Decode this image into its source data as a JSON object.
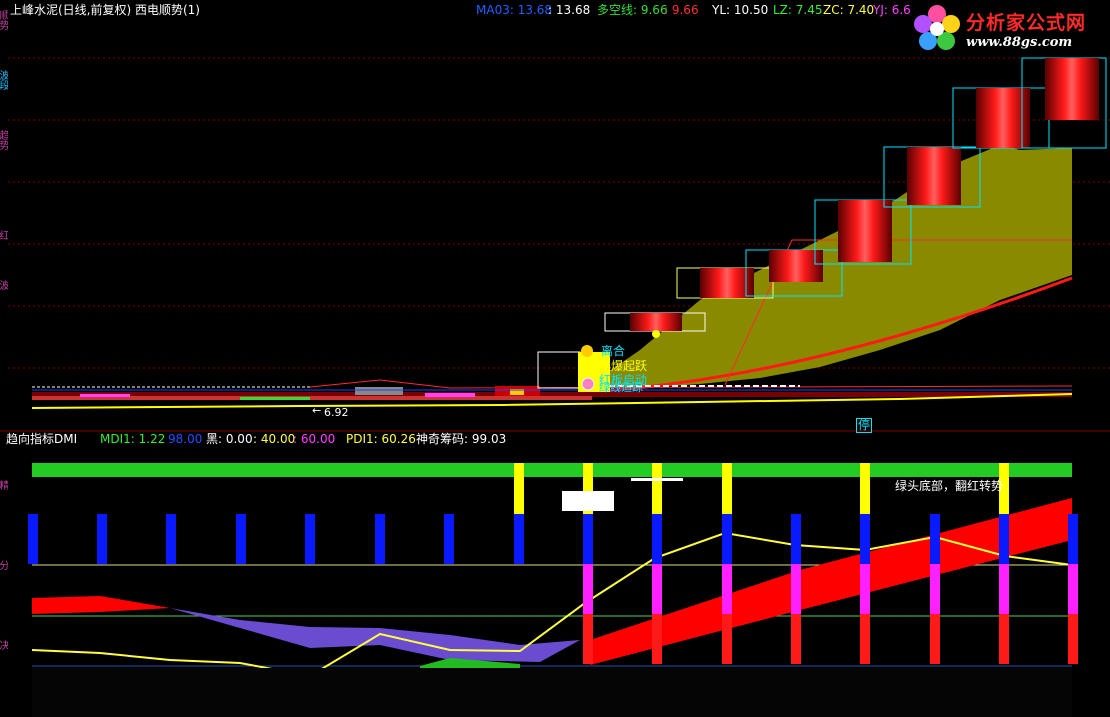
{
  "header": {
    "title": "上峰水泥(日线,前复权) 西电顺势(1)",
    "indicators": [
      {
        "label": "MA03: 13.68",
        "color": "#2060ff"
      },
      {
        "label": ": 13.68",
        "color": "#ffffff"
      },
      {
        "label": "多空线: 9.66",
        "color": "#33dd33"
      },
      {
        "label": ": 9.66",
        "color": "#ff3030"
      },
      {
        "label": "YL: 10.50",
        "color": "#ffffff"
      },
      {
        "label": "LZ: 7.45",
        "color": "#33ee33"
      },
      {
        "label": "ZC: 7.40",
        "color": "#ffff40"
      },
      {
        "label": "YJ: 6.6",
        "color": "#ff40ff"
      }
    ]
  },
  "logo": {
    "title": "分析家公式网",
    "url": "www.88gs.com"
  },
  "price_chart": {
    "annotations": {
      "label_1": "离合",
      "label_2": "起爆起跃",
      "label_3": "红板启动",
      "label_4": "绿线追踪",
      "low_price": "6.92",
      "stop_marker": "停"
    }
  },
  "indicator_panel": {
    "title": "趋向指标DMI",
    "values": [
      {
        "label": "MDI1: 1.22",
        "color": "#33ee33"
      },
      {
        "label": "98.00",
        "color": "#2050ff"
      },
      {
        "label": "黑: 0.00",
        "color": "#ffffff"
      },
      {
        "label": ": 40.00",
        "color": "#ffff40"
      },
      {
        "label": ": 60.00",
        "color": "#ff40ff"
      },
      {
        "label": "PDI1: 60.26",
        "color": "#ffff40"
      },
      {
        "label": "神奇筹码: 99.03",
        "color": "#ffffff"
      }
    ],
    "note": "绿头底部，翻红转势"
  },
  "sidebar": {
    "labels": [
      "顺势",
      "波段",
      "趋势",
      "红",
      "波",
      "精",
      "分",
      "决"
    ]
  },
  "colors": {
    "background": "#000000",
    "up_candle": "#cc0000",
    "outline": "#00e5ff",
    "fill": "#8a8a00",
    "band": "#ff0000",
    "yellow_line": "#ffff00"
  }
}
